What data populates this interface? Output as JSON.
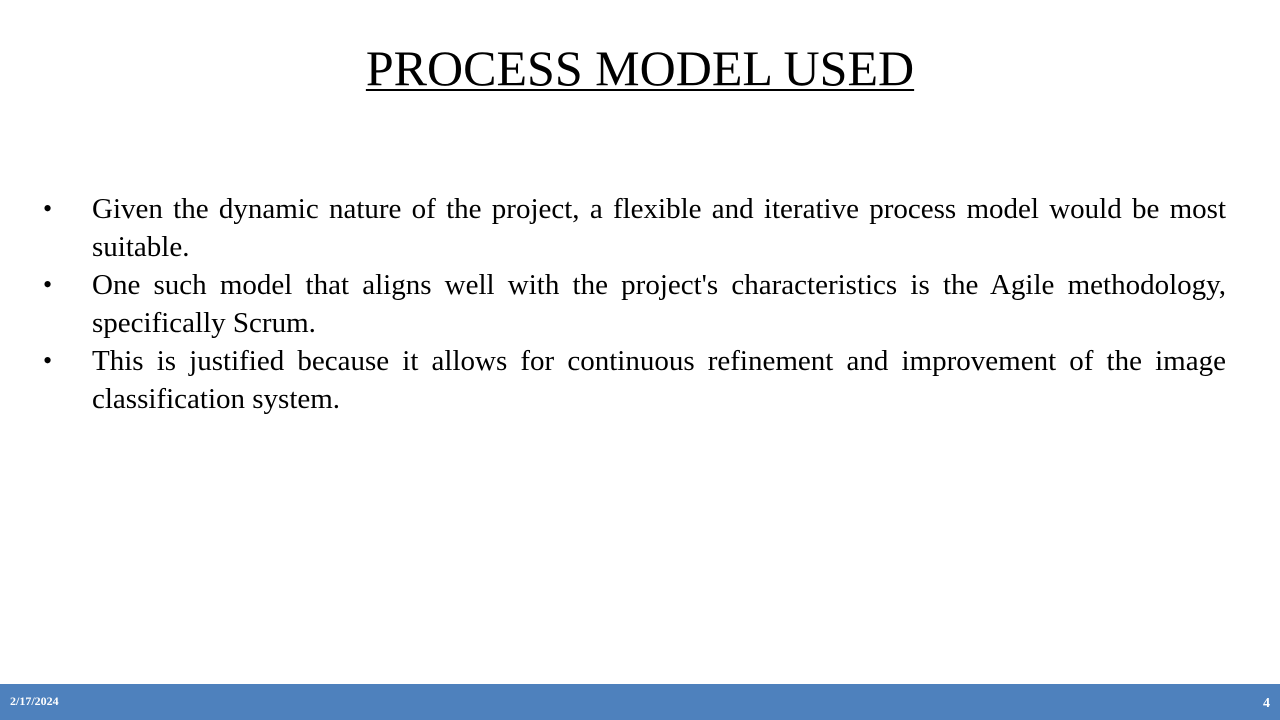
{
  "slide": {
    "title": "PROCESS MODEL USED",
    "bullets": [
      "Given the dynamic nature of the project, a flexible and iterative process model would be most suitable.",
      "One such model that aligns well with the project's characteristics is the Agile methodology, specifically Scrum.",
      "This is justified because it allows for continuous refinement and improvement of the image classification system."
    ],
    "bullet_symbol": "•"
  },
  "footer": {
    "date": "2/17/2024",
    "page_number": "4",
    "bar_color": "#4e81bd"
  }
}
